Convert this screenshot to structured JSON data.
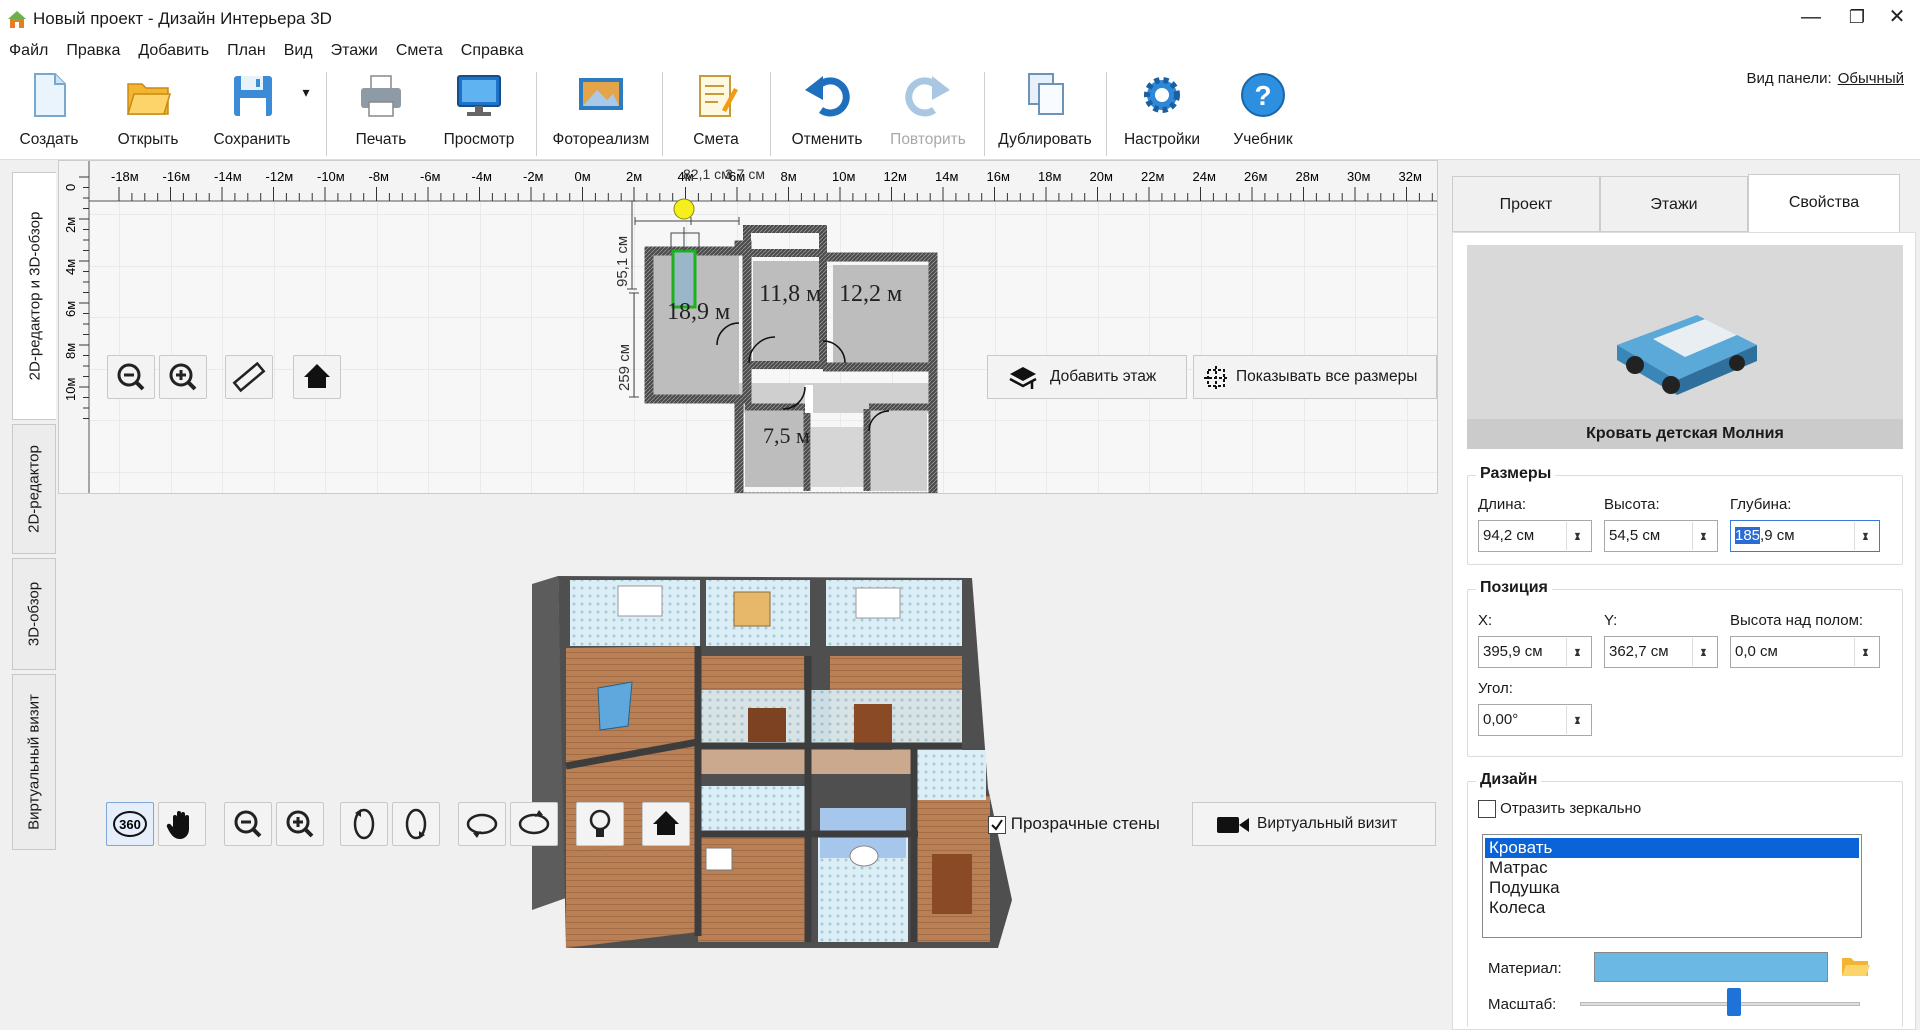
{
  "window": {
    "title": "Новый проект - Дизайн Интерьера 3D",
    "minimize": "—",
    "maximize": "❐",
    "close": "✕"
  },
  "menu": [
    "Файл",
    "Правка",
    "Добавить",
    "План",
    "Вид",
    "Этажи",
    "Смета",
    "Справка"
  ],
  "toolbar": {
    "create": "Создать",
    "open": "Открыть",
    "save": "Сохранить",
    "save_dropdown": "▾",
    "print": "Печать",
    "preview": "Просмотр",
    "photoreal": "Фотореализм",
    "estimate": "Смета",
    "undo": "Отменить",
    "redo": "Повторить",
    "duplicate": "Дублировать",
    "settings": "Настройки",
    "tutorial": "Учебник",
    "panel_view_label": "Вид панели:",
    "panel_view_value": "Обычный"
  },
  "left_tabs": [
    "2D-редактор и 3D-обзор",
    "2D-редактор",
    "3D-обзор",
    "Виртуальный визит"
  ],
  "ruler": {
    "top": [
      "-18м",
      "-16м",
      "-14м",
      "-12м",
      "-10м",
      "-8м",
      "-6м",
      "-4м",
      "-2м",
      "0м",
      "2м",
      "4м",
      "6м",
      "8м",
      "10м",
      "12м",
      "14м",
      "16м",
      "18м",
      "20м",
      "22м",
      "24м",
      "26м",
      "28м",
      "30м",
      "32м"
    ],
    "left": [
      "0",
      "2м",
      "4м",
      "6м",
      "8м",
      "10м"
    ]
  },
  "plan": {
    "dim_top": "82,1 см",
    "dim_top2": "3,7 см",
    "dim_left1": "95,1 см",
    "dim_left2": "259 см",
    "areas": [
      "18,9 м",
      "11,8 м",
      "12,2 м",
      "7,5 м"
    ],
    "add_floor": "Добавить этаж",
    "show_dims": "Показывать все размеры"
  },
  "view3d": {
    "transparent_walls": "Прозрачные стены",
    "virtual_visit": "Виртуальный визит",
    "transparent_checked": true,
    "btn_360": "360"
  },
  "right": {
    "tabs": [
      "Проект",
      "Этажи",
      "Свойства"
    ],
    "preview_caption": "Кровать детская Молния",
    "sizes_title": "Размеры",
    "length_label": "Длина:",
    "length": "94,2 см",
    "height_label": "Высота:",
    "height": "54,5 см",
    "depth_label": "Глубина:",
    "depth_sel": "185",
    "depth_rest": ",9 см",
    "position_title": "Позиция",
    "x_label": "X:",
    "x": "395,9 см",
    "y_label": "Y:",
    "y": "362,7 см",
    "floor_height_label": "Высота над полом:",
    "floor_height": "0,0 см",
    "angle_label": "Угол:",
    "angle": "0,00°",
    "design_title": "Дизайн",
    "mirror_label": "Отразить зеркально",
    "parts": [
      "Кровать",
      "Матрас",
      "Подушка",
      "Колеса"
    ],
    "material_label": "Материал:",
    "material_color": "#6bb8e4",
    "scale_label": "Масштаб:",
    "scale_value": 0.55
  }
}
